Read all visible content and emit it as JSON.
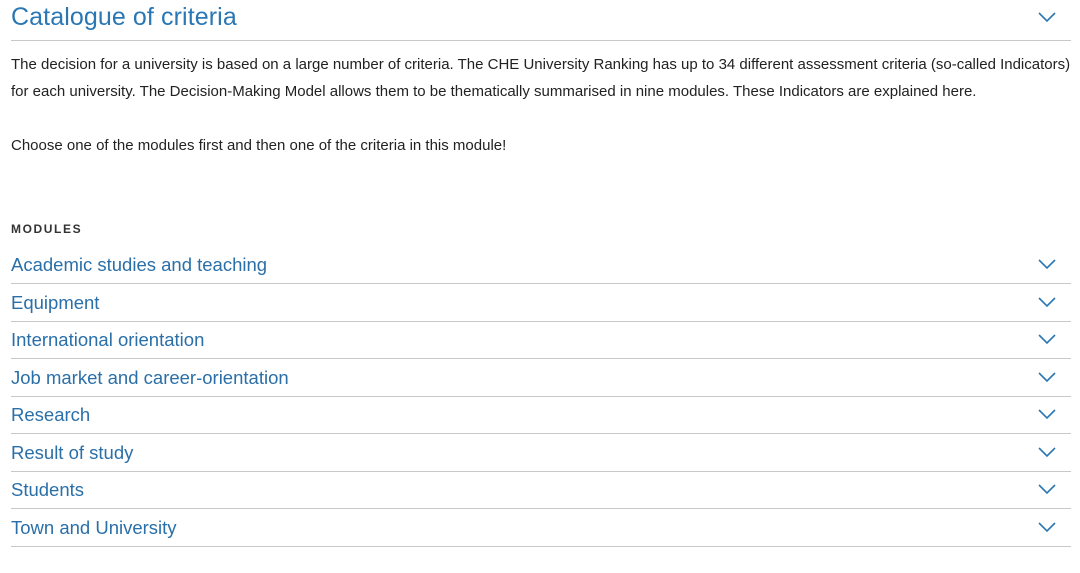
{
  "header": {
    "title": "Catalogue of criteria",
    "toggle_icon": "chevron-down-icon"
  },
  "intro": {
    "paragraph1": "The decision for a university is based on a large number of criteria. The CHE University Ranking has up to 34 different assessment criteria (so-called Indicators) for each university. The Decision-Making Model allows them to be thematically summarised in nine modules. These Indicators are explained here.",
    "paragraph2": "Choose one of the modules first and then one of the criteria in this module!"
  },
  "modules": {
    "heading": "MODULES",
    "items": [
      {
        "label": "Academic studies and teaching"
      },
      {
        "label": "Equipment"
      },
      {
        "label": "International orientation"
      },
      {
        "label": "Job market and career-orientation"
      },
      {
        "label": "Research"
      },
      {
        "label": "Result of study"
      },
      {
        "label": "Students"
      },
      {
        "label": "Town and University"
      }
    ]
  },
  "colors": {
    "accent": "#2a77b3",
    "module_link": "#2a6fa8",
    "divider": "#c8c8c8",
    "text": "#222222"
  }
}
